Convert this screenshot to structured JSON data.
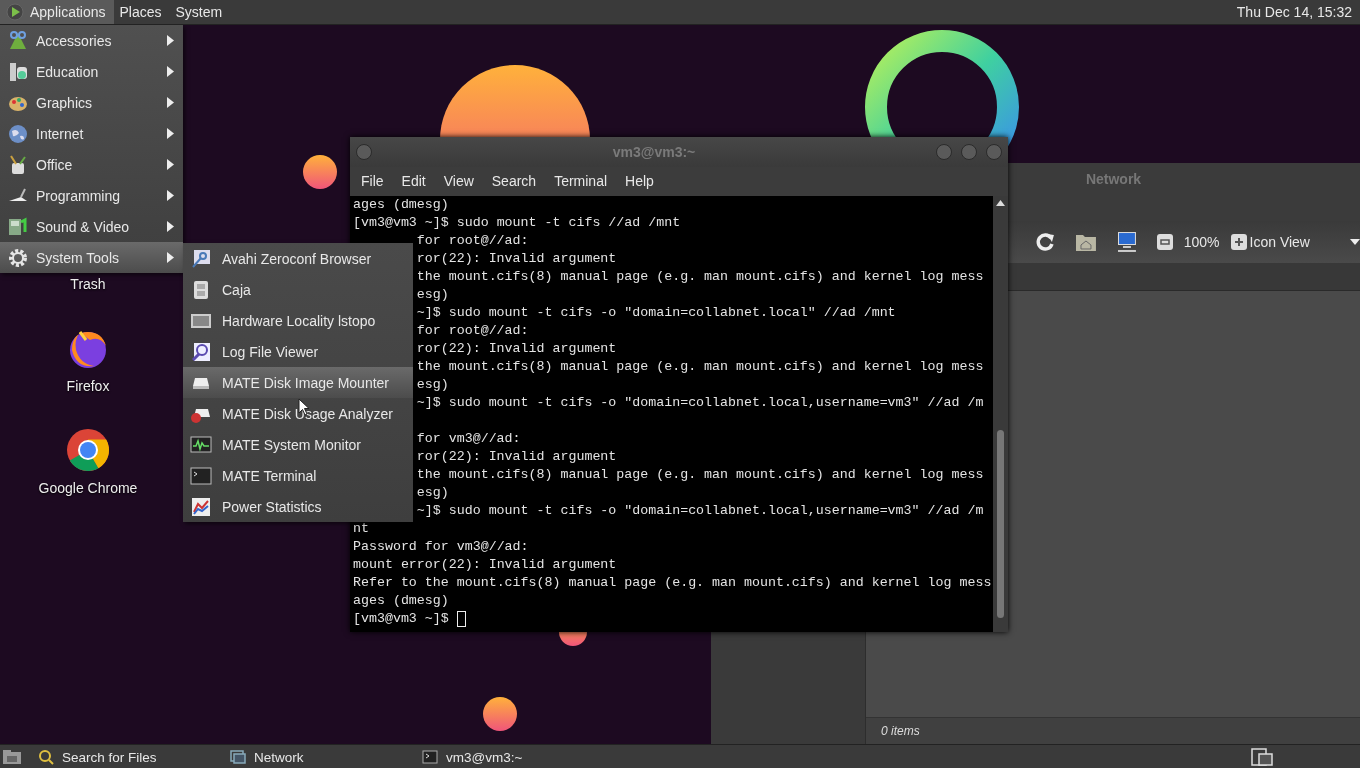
{
  "top_panel": {
    "menus": [
      {
        "label": "Applications",
        "selected": true
      },
      {
        "label": "Places",
        "selected": false
      },
      {
        "label": "System",
        "selected": false
      }
    ],
    "clock": "Thu Dec 14, 15:32"
  },
  "applications_menu": {
    "items": [
      {
        "label": "Accessories",
        "selected": false
      },
      {
        "label": "Education",
        "selected": false
      },
      {
        "label": "Graphics",
        "selected": false
      },
      {
        "label": "Internet",
        "selected": false
      },
      {
        "label": "Office",
        "selected": false
      },
      {
        "label": "Programming",
        "selected": false
      },
      {
        "label": "Sound & Video",
        "selected": false
      },
      {
        "label": "System Tools",
        "selected": true
      }
    ]
  },
  "submenu": {
    "items": [
      {
        "label": "Avahi Zeroconf Browser",
        "selected": false
      },
      {
        "label": "Caja",
        "selected": false
      },
      {
        "label": "Hardware Locality lstopo",
        "selected": false
      },
      {
        "label": "Log File Viewer",
        "selected": false
      },
      {
        "label": "MATE Disk Image Mounter",
        "selected": true
      },
      {
        "label": "MATE Disk Usage Analyzer",
        "selected": false
      },
      {
        "label": "MATE System Monitor",
        "selected": false
      },
      {
        "label": "MATE Terminal",
        "selected": false
      },
      {
        "label": "Power Statistics",
        "selected": false
      }
    ]
  },
  "desktop_icons": [
    {
      "label": "Trash",
      "kind": "trash"
    },
    {
      "label": "Firefox",
      "kind": "fox"
    },
    {
      "label": "Google Chrome",
      "kind": "sphere"
    }
  ],
  "terminal": {
    "title": "vm3@vm3:~",
    "menus": [
      "File",
      "Edit",
      "View",
      "Search",
      "Terminal",
      "Help"
    ],
    "lines": [
      {
        "kind": "text",
        "text": "ages (dmesg)",
        "behind_menu": false
      },
      {
        "kind": "text",
        "text": "[vm3@vm3 ~]$ sudo mount -t cifs //ad /mnt",
        "behind_menu": false
      },
      {
        "kind": "text",
        "text": "for root@//ad:",
        "behind_menu": true
      },
      {
        "kind": "text",
        "text": "ror(22): Invalid argument",
        "behind_menu": true
      },
      {
        "kind": "text",
        "text": "the mount.cifs(8) manual page (e.g. man mount.cifs) and kernel log mess",
        "behind_menu": true
      },
      {
        "kind": "text",
        "text": "esg)",
        "behind_menu": true
      },
      {
        "kind": "text",
        "text": "~]$ sudo mount -t cifs -o \"domain=collabnet.local\" //ad /mnt",
        "behind_menu": true
      },
      {
        "kind": "text",
        "text": "for root@//ad:",
        "behind_menu": true
      },
      {
        "kind": "text",
        "text": "ror(22): Invalid argument",
        "behind_menu": true
      },
      {
        "kind": "text",
        "text": "the mount.cifs(8) manual page (e.g. man mount.cifs) and kernel log mess",
        "behind_menu": true
      },
      {
        "kind": "text",
        "text": "esg)",
        "behind_menu": true
      },
      {
        "kind": "text",
        "text": "~]$ sudo mount -t cifs -o \"domain=collabnet.local,username=vm3\" //ad /m",
        "behind_menu": true
      },
      {
        "kind": "blank"
      },
      {
        "kind": "text",
        "text": "for vm3@//ad:",
        "behind_menu": true
      },
      {
        "kind": "text",
        "text": "ror(22): Invalid argument",
        "behind_menu": true
      },
      {
        "kind": "text",
        "text": "the mount.cifs(8) manual page (e.g. man mount.cifs) and kernel log mess",
        "behind_menu": true
      },
      {
        "kind": "text",
        "text": "esg)",
        "behind_menu": true
      },
      {
        "kind": "text",
        "text": "~]$ sudo mount -t cifs -o \"domain=collabnet.local,username=vm3\" //ad /m",
        "behind_menu": true
      },
      {
        "kind": "text",
        "text": "nt",
        "behind_menu": false
      },
      {
        "kind": "text",
        "text": "Password for vm3@//ad:",
        "behind_menu": false
      },
      {
        "kind": "text",
        "text": "mount error(22): Invalid argument",
        "behind_menu": false
      },
      {
        "kind": "text",
        "text": "Refer to the mount.cifs(8) manual page (e.g. man mount.cifs) and kernel log mess",
        "behind_menu": false
      },
      {
        "kind": "text",
        "text": "ages (dmesg)",
        "behind_menu": false
      }
    ],
    "prompt": "[vm3@vm3 ~]$"
  },
  "file_manager": {
    "title": "Network",
    "zoom": "100%",
    "view": "Icon View",
    "status": "0 items"
  },
  "taskbar": {
    "items": [
      {
        "label": "Search for Files",
        "kind": "search"
      },
      {
        "label": "Network",
        "kind": "window"
      },
      {
        "label": "vm3@vm3:~",
        "kind": "terminal"
      }
    ]
  }
}
